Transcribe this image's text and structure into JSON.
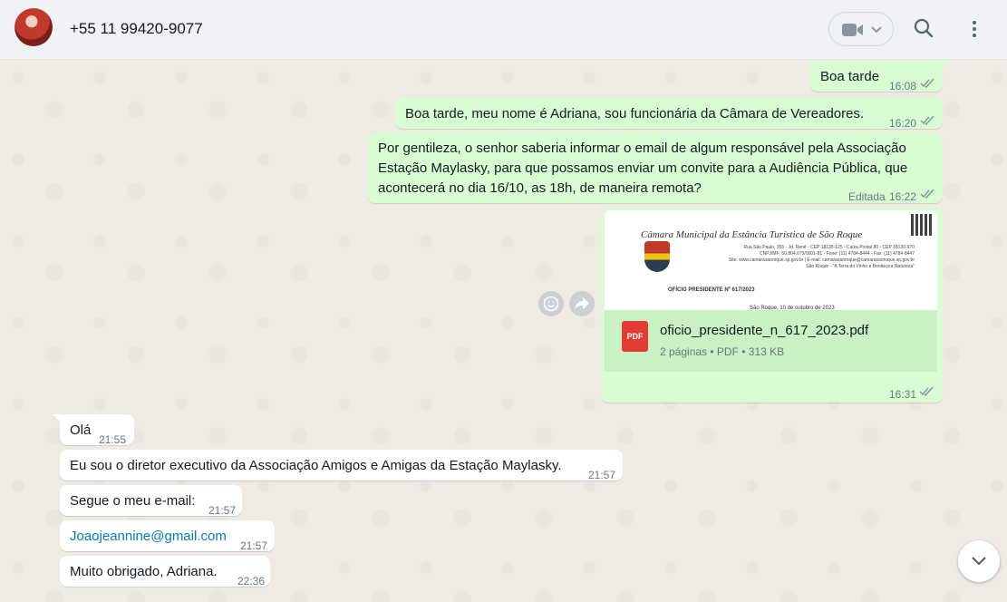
{
  "header": {
    "contact_name": "+55 11 99420-9077"
  },
  "messages": [
    {
      "direction": "out",
      "text": "Boa tarde",
      "time": "16:08",
      "status": "read"
    },
    {
      "direction": "out",
      "text": "Boa tarde, meu nome é Adriana, sou funcionária da Câmara de Vereadores.",
      "time": "16:20",
      "status": "read"
    },
    {
      "direction": "out",
      "lines": [
        "Por gentileza, o senhor saberia informar o email de algum responsável pela Associação",
        "Estação Maylasky, para que possamos enviar um convite para a Audiência Pública, que",
        "acontecerá no dia 16/10, as 18h, de maneira remota?"
      ],
      "edited_label": "Editada",
      "time": "16:22",
      "status": "read"
    },
    {
      "direction": "out",
      "type": "document",
      "preview": {
        "letterhead": "Câmara Municipal da Estância Turística de São Roque",
        "address_lines": [
          "Rua São Paulo, 355 - Jd. Renê - CEP 18135-125 - Caixa Postal 80 - CEP 18130-970",
          "CNPJ/MF: 50.804.079/0001-81 - Fone: (11) 4784-8444 - Fax: (11) 4784-8447",
          "Site: www.camarasaoroque.sp.gov.br | E-mail: camarasaoroque@camarasaoroque.sp.gov.br",
          "São Roque - \"A Terra do Vinho e Bonita por Natureza\""
        ],
        "doc_title": "OFÍCIO PRESIDENTE Nº 617/2023",
        "date_line": "São Roque, 10 de outubro de 2023"
      },
      "file_name": "oficio_presidente_n_617_2023.pdf",
      "file_meta": "2 páginas • PDF • 313 KB",
      "file_icon_label": "PDF",
      "time": "16:31",
      "status": "read"
    },
    {
      "direction": "in",
      "text": "Olá",
      "time": "21:55"
    },
    {
      "direction": "in",
      "text": "Eu sou o diretor executivo da Associação Amigos e Amigas da Estação Maylasky.",
      "time": "21:57"
    },
    {
      "direction": "in",
      "text": "Segue o meu e-mail:",
      "time": "21:57"
    },
    {
      "direction": "in",
      "text": "Joaojeannine@gmail.com",
      "time": "21:57",
      "is_link": true
    },
    {
      "direction": "in",
      "text": "Muito obrigado, Adriana.",
      "time": "22:36"
    }
  ],
  "icons": [
    "video-call-icon",
    "chevron-down-icon",
    "search-icon",
    "menu-dots-icon",
    "emoji-react-icon",
    "forward-icon",
    "double-check-icon",
    "pdf-icon",
    "scroll-down-icon"
  ],
  "colors": {
    "outgoing_bubble": "#d9fdd3",
    "incoming_bubble": "#ffffff",
    "chat_background": "#efeae2",
    "read_ticks": "#8696a0",
    "link": "#027eb5"
  }
}
